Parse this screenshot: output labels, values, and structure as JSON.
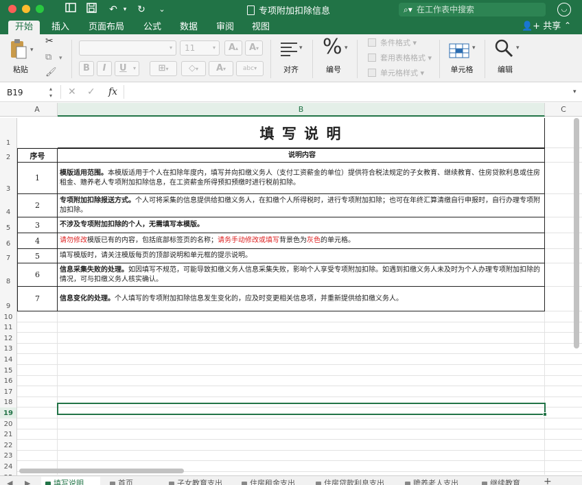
{
  "window": {
    "title": "专项附加扣除信息",
    "search_placeholder": "在工作表中搜索"
  },
  "tabs": [
    {
      "label": "开始",
      "active": true
    },
    {
      "label": "插入"
    },
    {
      "label": "页面布局"
    },
    {
      "label": "公式"
    },
    {
      "label": "数据"
    },
    {
      "label": "审阅"
    },
    {
      "label": "视图"
    }
  ],
  "share_label": "共享",
  "ribbon": {
    "paste": "粘贴",
    "font_size": "11",
    "grow_font": "A",
    "shrink_font": "A",
    "bold": "B",
    "italic": "I",
    "underline": "U",
    "font_color": "A",
    "phonetic": "abc",
    "align": "对齐",
    "number": "编号",
    "conditional_format": "条件格式",
    "table_format": "套用表格格式",
    "cell_style": "单元格样式",
    "cells": "单元格",
    "edit": "编辑"
  },
  "formula_bar": {
    "cell_ref": "B19",
    "fx": "fx"
  },
  "columns": [
    "A",
    "B",
    "C"
  ],
  "rows": [
    "1",
    "2",
    "3",
    "4",
    "5",
    "6",
    "7",
    "8",
    "9",
    "10",
    "11",
    "12",
    "13",
    "14",
    "15",
    "16",
    "17",
    "18",
    "19",
    "20",
    "21",
    "22",
    "23",
    "24",
    "25"
  ],
  "sheet": {
    "title": "填 写 说 明",
    "header_no": "序号",
    "header_content": "说明内容",
    "items": [
      {
        "no": "1",
        "bold": "模版适用范围。",
        "text": "本模版适用于个人在扣除年度内，填写并向扣缴义务人（支付工资薪金的单位）提供符合税法规定的子女教育、继续教育、住房贷款利息或住房租金、赡养老人专项附加扣除信息，在工资薪金所得预扣预缴时进行税前扣除。"
      },
      {
        "no": "2",
        "bold": "专项附加扣除报送方式。",
        "text": "个人可将采集的信息提供给扣缴义务人，在扣缴个人所得税时，进行专项附加扣除；也可在年终汇算清缴自行申报时，自行办理专项附加扣除。"
      },
      {
        "no": "3",
        "bold": "不涉及专项附加扣除的个人，无需填写本模版。",
        "text": ""
      },
      {
        "no": "4",
        "red1": "请勿修改",
        "t1": "模版已有的内容，包括底部标签页的名称；",
        "red2": "请务手动修改或填写",
        "t2": "背景色为",
        "red3": "灰色",
        "t3": "的单元格。"
      },
      {
        "no": "5",
        "bold": "",
        "text": "填写模版时，请关注模版每页的顶部说明和单元框的提示说明。"
      },
      {
        "no": "6",
        "bold": "信息采集失败的处理。",
        "text": "如因填写不规范，可能导致扣缴义务人信息采集失败，影响个人享受专项附加扣除。如遇到扣缴义务人未及时为个人办理专项附加扣除的情况，可与扣缴义务人核实确认。"
      },
      {
        "no": "7",
        "bold": "信息变化的处理。",
        "text": "个人填写的专项附加扣除信息发生变化的，应及时变更相关信息项，并重新提供给扣缴义务人。"
      }
    ]
  },
  "sheet_tabs": [
    {
      "label": "填写说明",
      "active": true
    },
    {
      "label": "首页"
    },
    {
      "label": "子女教育支出"
    },
    {
      "label": "住房租金支出"
    },
    {
      "label": "住房贷款利息支出"
    },
    {
      "label": "赡养老人支出"
    },
    {
      "label": "继续教育"
    }
  ]
}
